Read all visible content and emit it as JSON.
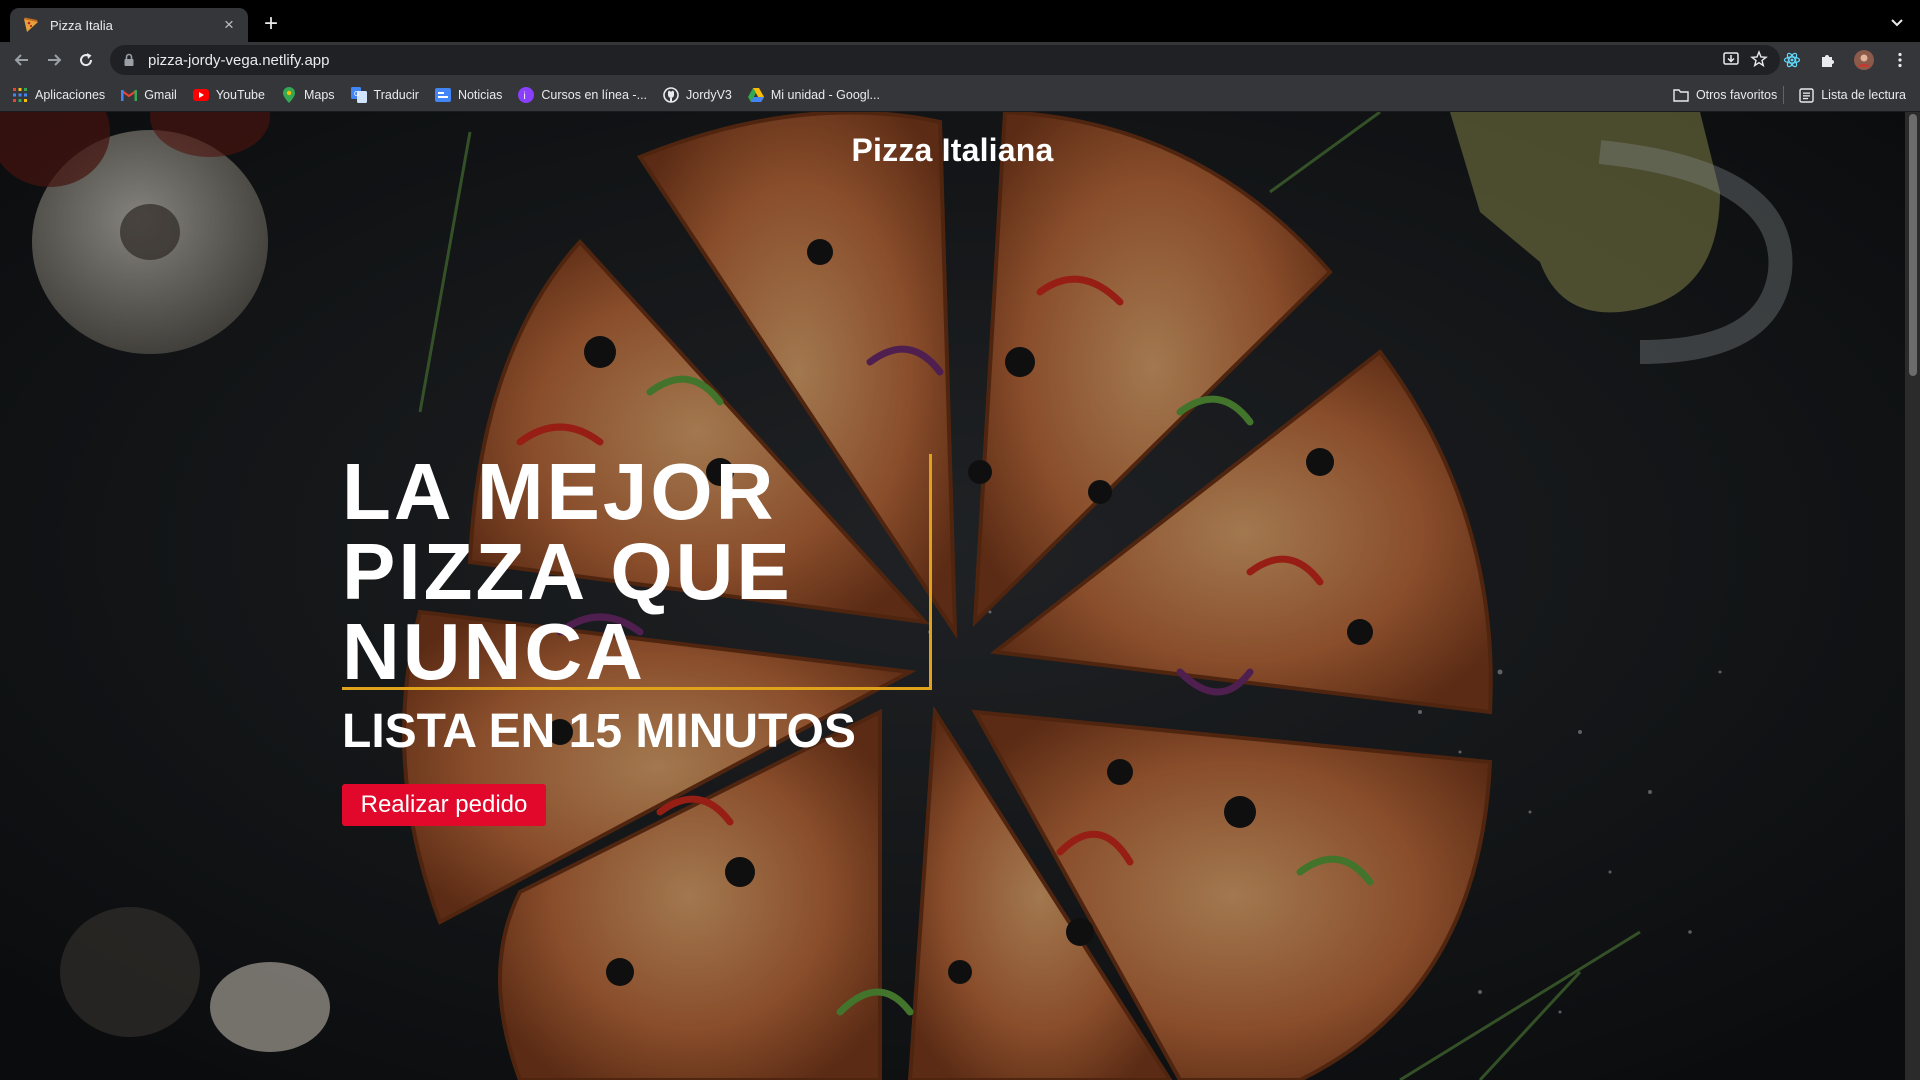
{
  "browser": {
    "tab": {
      "title": "Pizza Italia",
      "favicon": "pizza-icon"
    },
    "url": "pizza-jordy-vega.netlify.app",
    "bookmarks": [
      {
        "label": "Aplicaciones",
        "icon": "apps-grid-icon"
      },
      {
        "label": "Gmail",
        "icon": "gmail-icon"
      },
      {
        "label": "YouTube",
        "icon": "youtube-icon"
      },
      {
        "label": "Maps",
        "icon": "maps-icon"
      },
      {
        "label": "Traducir",
        "icon": "translate-icon"
      },
      {
        "label": "Noticias",
        "icon": "news-icon"
      },
      {
        "label": "Cursos en línea -...",
        "icon": "courses-icon"
      },
      {
        "label": "JordyV3",
        "icon": "github-icon"
      },
      {
        "label": "Mi unidad - Googl...",
        "icon": "drive-icon"
      }
    ],
    "other_bookmarks": "Otros favoritos",
    "reading_list": "Lista de lectura"
  },
  "page": {
    "brand": "Pizza Italiana",
    "hero_title": "LA MEJOR PIZZA QUE NUNCA",
    "hero_subtitle": "LISTA EN 15 MINUTOS",
    "cta_label": "Realizar pedido"
  },
  "colors": {
    "accent_gold": "#e0a21b",
    "cta_red": "#e1082b",
    "background_dark": "#16181b"
  }
}
